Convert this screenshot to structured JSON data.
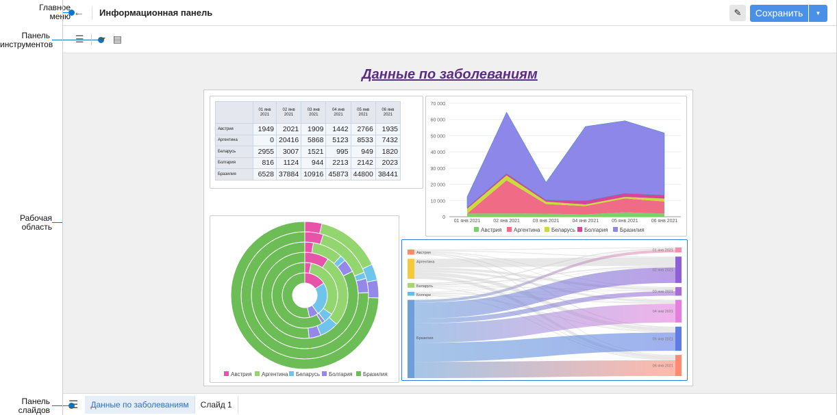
{
  "annotations": {
    "main_menu": "Главное меню",
    "toolbar": "Панель инструментов",
    "workspace": "Рабочая область",
    "slides_panel": "Панель слайдов"
  },
  "header": {
    "title": "Информационная панель",
    "save_label": "Сохранить",
    "icons": [
      "arrow-left-icon",
      "pencil-icon",
      "caret-down-icon"
    ]
  },
  "dashboard": {
    "title": "Данные по заболеваниям"
  },
  "table": {
    "columns": [
      "01 янв 2021",
      "02 янв 2021",
      "03 янв 2021",
      "04 янв 2021",
      "05 янв 2021",
      "06 янв 2021"
    ],
    "rows": [
      {
        "label": "Австрия",
        "values": [
          1949,
          2021,
          1909,
          1442,
          2766,
          1935
        ]
      },
      {
        "label": "Аргентина",
        "values": [
          0,
          20416,
          5868,
          5123,
          8533,
          7432
        ]
      },
      {
        "label": "Беларусь",
        "values": [
          2955,
          3007,
          1521,
          995,
          949,
          1820
        ]
      },
      {
        "label": "Болгария",
        "values": [
          816,
          1124,
          944,
          2213,
          2142,
          2023
        ]
      },
      {
        "label": "Бразилия",
        "values": [
          6528,
          37884,
          10916,
          45873,
          44800,
          38441
        ]
      }
    ]
  },
  "chart_data": [
    {
      "type": "area",
      "stacked": true,
      "categories": [
        "01 янв 2021",
        "02 янв 2021",
        "03 янв 2021",
        "04 янв 2021",
        "05 янв 2021",
        "06 янв 2021"
      ],
      "yticks": [
        "0",
        "10 000",
        "20 000",
        "30 000",
        "40 000",
        "50 000",
        "60 000",
        "70 000"
      ],
      "ylim": [
        0,
        70000
      ],
      "legend": "bottom",
      "series": [
        {
          "name": "Австрия",
          "color": "#7ccf6a",
          "values": [
            1949,
            2021,
            1909,
            1442,
            2766,
            1935
          ]
        },
        {
          "name": "Аргентина",
          "color": "#ef6b86",
          "values": [
            0,
            20416,
            5868,
            5123,
            8533,
            7432
          ]
        },
        {
          "name": "Беларусь",
          "color": "#c8dc3c",
          "values": [
            2955,
            3007,
            1521,
            995,
            949,
            1820
          ]
        },
        {
          "name": "Болгария",
          "color": "#d9449a",
          "values": [
            816,
            1124,
            944,
            2213,
            2142,
            2023
          ]
        },
        {
          "name": "Бразилия",
          "color": "#8c87e8",
          "values": [
            6528,
            37884,
            10916,
            45873,
            44800,
            38441
          ]
        }
      ]
    },
    {
      "type": "sunburst",
      "legend": "bottom",
      "rings": "one ring per date, inner = 01 янв 2021",
      "series": [
        {
          "name": "Австрия",
          "color": "#e653a8"
        },
        {
          "name": "Аргентина",
          "color": "#93d56e"
        },
        {
          "name": "Беларусь",
          "color": "#6ec4ea"
        },
        {
          "name": "Болгария",
          "color": "#9488e8"
        },
        {
          "name": "Бразилия",
          "color": "#6cbd55"
        }
      ]
    },
    {
      "type": "sankey",
      "sources": [
        {
          "name": "Австрия",
          "color": "#ff8a65"
        },
        {
          "name": "Аргентина",
          "color": "#f4ca3a"
        },
        {
          "name": "Беларусь",
          "color": "#a8d46f"
        },
        {
          "name": "Болгари",
          "color": "#5bc0eb"
        },
        {
          "name": "Бразилия",
          "color": "#6a9fd8"
        }
      ],
      "targets": [
        {
          "name": "01 янв 2021",
          "color": "#f48fb1"
        },
        {
          "name": "02 янв 2021",
          "color": "#8e5fd6"
        },
        {
          "name": "03 янв 2021",
          "color": "#a66dd4"
        },
        {
          "name": "04 янв 2021",
          "color": "#e57fdc"
        },
        {
          "name": "05 янв 2021",
          "color": "#5f7de3"
        },
        {
          "name": "06 янв 2021",
          "color": "#ff8a73"
        }
      ]
    }
  ],
  "slides": {
    "tabs": [
      "Данные по заболеваниям",
      "Слайд 1"
    ]
  }
}
